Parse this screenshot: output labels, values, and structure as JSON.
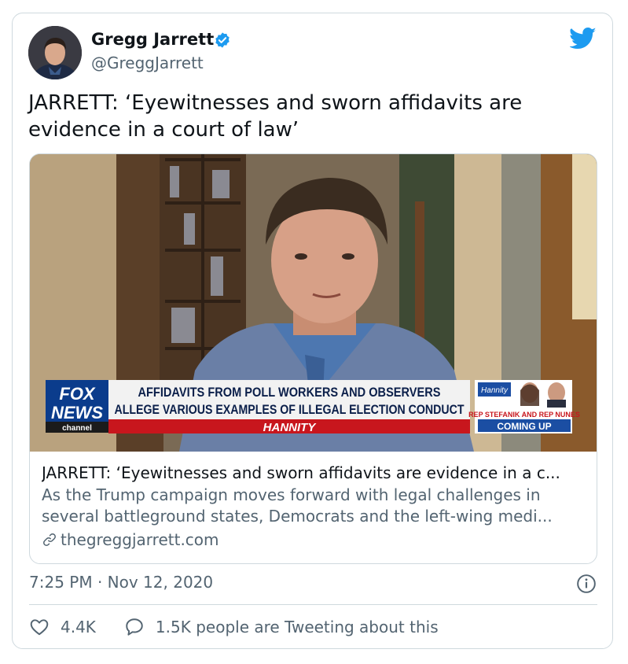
{
  "tweet": {
    "display_name": "Gregg Jarrett",
    "handle": "@GreggJarrett",
    "text": "JARRETT: ‘Eyewitnesses and sworn affidavits are evidence in a court of law’",
    "timestamp": "7:25 PM · Nov 12, 2020",
    "likes": "4.4K",
    "conversation": "1.5K people are Tweeting about this"
  },
  "card": {
    "title": "JARRETT: ‘Eyewitnesses and sworn affidavits are evidence in a c...",
    "description": "As the Trump campaign moves forward with legal challenges in several battleground states, Democrats and the left-wing medi...",
    "domain": "thegreggjarrett.com"
  },
  "chyron": {
    "headline_line1": "AFFIDAVITS FROM POLL WORKERS AND OBSERVERS",
    "headline_line2": "ALLEGE VARIOUS EXAMPLES OF ILLEGAL ELECTION CONDUCT",
    "show": "HANNITY",
    "logo_fox": "FOX",
    "logo_news": "NEWS",
    "logo_channel": "channel",
    "promo_brand": "Hannity",
    "promo_names": "REP STEFANIK AND REP NUNES",
    "promo_coming": "COMING UP"
  },
  "colors": {
    "accent": "#1d9bf0",
    "text_primary": "#0f1419",
    "text_secondary": "#536471",
    "border": "#cfd9de",
    "chyron_red": "#c8161d",
    "chyron_blue": "#0b3c8c"
  },
  "icons": {
    "verified": "verified-badge-icon",
    "brand": "twitter-bird-icon",
    "info": "info-icon",
    "like": "heart-icon",
    "reply": "speech-bubble-icon",
    "link": "link-icon"
  }
}
